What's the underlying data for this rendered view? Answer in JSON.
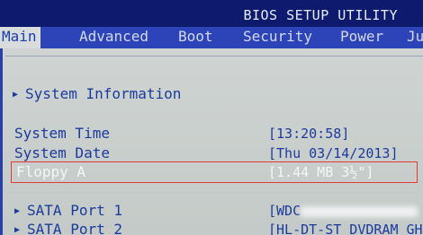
{
  "window": {
    "title": "BIOS SETUP UTILITY"
  },
  "menu": {
    "tabs": [
      {
        "label": "Main",
        "active": true
      },
      {
        "label": "Advanced"
      },
      {
        "label": "Boot"
      },
      {
        "label": "Security"
      },
      {
        "label": "Power"
      },
      {
        "label": "Ju"
      }
    ]
  },
  "main": {
    "system_information": "System Information",
    "system_time": {
      "label": "System Time",
      "value": "[13:20:58]"
    },
    "system_date": {
      "label": "System Date",
      "value": "[Thu 03/14/2013]"
    },
    "floppy_a": {
      "label": "Floppy A",
      "value": "[1.44 MB 3½\"]"
    },
    "sata_port_1": {
      "label": "SATA Port 1",
      "value": "[WDC"
    },
    "sata_port_2": {
      "label": "SATA Port 2",
      "value": "[HL-DT-ST DVDRAM GH"
    }
  },
  "colors": {
    "title_bg": "#0e1a6e",
    "menu_bg": "#2c44b8",
    "panel_bg": "#cfd4d2",
    "text_blue": "#1c3a9e",
    "highlight_border": "#e23a35"
  }
}
